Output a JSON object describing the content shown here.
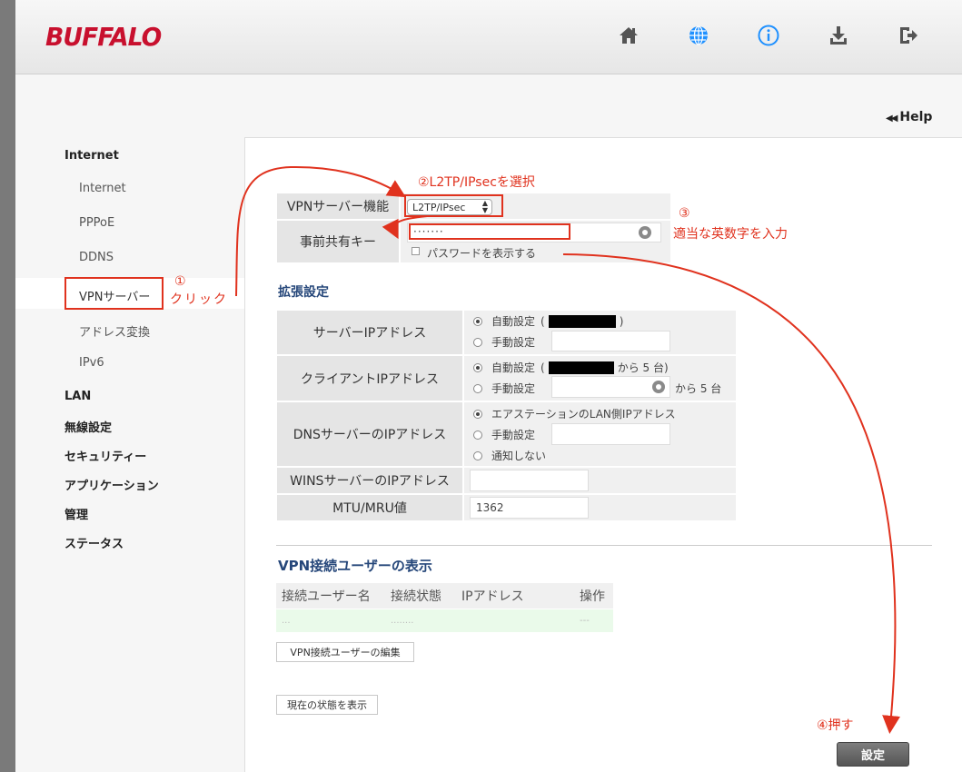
{
  "header": {
    "logo": "BUFFALO",
    "icons": [
      "home-icon",
      "globe-icon",
      "info-icon",
      "download-icon",
      "logout-icon"
    ],
    "help_label": "Help"
  },
  "sidebar": {
    "internet_head": "Internet",
    "internet_items": [
      "Internet",
      "PPPoE",
      "DDNS",
      "VPNサーバー",
      "アドレス変換",
      "IPv6"
    ],
    "other_heads": [
      "LAN",
      "無線設定",
      "セキュリティー",
      "アプリケーション",
      "管理",
      "ステータス"
    ]
  },
  "vpn": {
    "function_label": "VPNサーバー機能",
    "function_value": "L2TP/IPsec",
    "psk_label": "事前共有キー",
    "psk_value": "·······",
    "show_password_label": "パスワードを表示する"
  },
  "extended": {
    "title": "拡張設定",
    "server_ip_label": "サーバーIPアドレス",
    "client_ip_label": "クライアントIPアドレス",
    "dns_label": "DNSサーバーのIPアドレス",
    "wins_label": "WINSサーバーのIPアドレス",
    "mtu_label": "MTU/MRU値",
    "auto_label": "自動設定",
    "paren_open": "(",
    "paren_close": ")",
    "manual_label": "手動設定",
    "range_suffix": "から 5 台)",
    "manual_range_suffix": "から 5 台",
    "dns_option_lan": "エアステーションのLAN側IPアドレス",
    "dns_option_none": "通知しない",
    "mtu_value": "1362"
  },
  "users": {
    "title": "VPN接続ユーザーの表示",
    "columns": [
      "接続ユーザー名",
      "接続状態",
      "IPアドレス",
      "操作"
    ],
    "row_placeholders": [
      "...",
      "........",
      "",
      "---"
    ],
    "edit_button": "VPN接続ユーザーの編集",
    "status_button": "現在の状態を表示"
  },
  "save_button": "設定",
  "annotations": {
    "step1_num": "①",
    "step1": "クリック",
    "step2": "②L2TP/IPsecを選択",
    "step3_num": "③",
    "step3": "適当な英数字を入力",
    "step4": "④押す"
  },
  "colors": {
    "brand": "#c8102e",
    "annotation": "#e0321e",
    "section_title": "#26477a",
    "globe_active": "#1e90ff"
  }
}
